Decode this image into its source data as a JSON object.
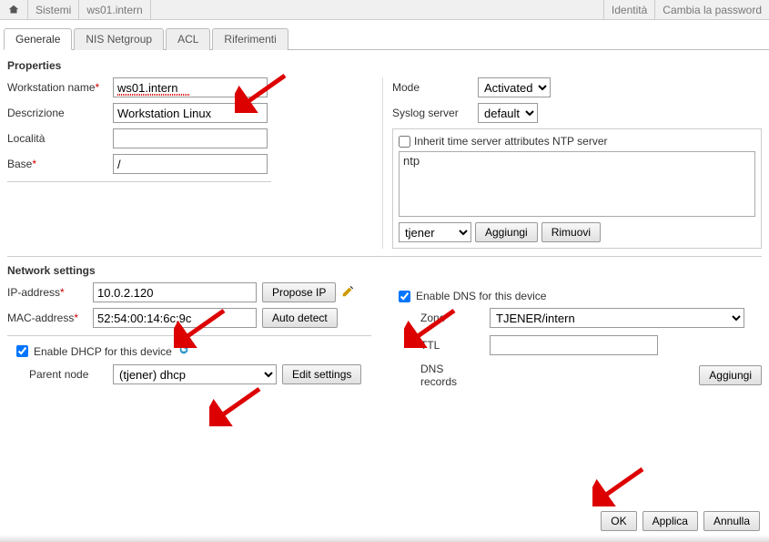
{
  "topbar": {
    "systems": "Sistemi",
    "node": "ws01.intern",
    "identity": "Identità",
    "change_password": "Cambia la password"
  },
  "tabs": {
    "general": "Generale",
    "nis": "NIS Netgroup",
    "acl": "ACL",
    "refs": "Riferimenti"
  },
  "sections": {
    "properties": "Properties",
    "network": "Network settings"
  },
  "props": {
    "workstation_label": "Workstation name",
    "workstation_value": "ws01.intern",
    "desc_label": "Descrizione",
    "desc_value": "Workstation Linux",
    "location_label": "Località",
    "location_value": "",
    "base_label": "Base",
    "base_value": "/",
    "mode_label": "Mode",
    "mode_value": "Activated",
    "syslog_label": "Syslog server",
    "syslog_value": "default",
    "ntp_inherit": "Inherit time server attributes NTP server",
    "ntp_item": "ntp",
    "ntp_select": "tjener",
    "add": "Aggiungi",
    "remove": "Rimuovi"
  },
  "net": {
    "ip_label": "IP-address",
    "ip_value": "10.0.2.120",
    "propose": "Propose IP",
    "mac_label": "MAC-address",
    "mac_value": "52:54:00:14:6c:9c",
    "autodetect": "Auto detect",
    "dhcp_label": "Enable DHCP for this device",
    "parent_label": "Parent node",
    "parent_value": "(tjener) dhcp",
    "edit": "Edit settings",
    "dns_enable": "Enable DNS for this device",
    "zone_label": "Zone",
    "zone_value": "TJENER/intern",
    "ttl_label": "TTL",
    "ttl_value": "",
    "records_label": "DNS records",
    "records_add": "Aggiungi"
  },
  "footer": {
    "ok": "OK",
    "apply": "Applica",
    "cancel": "Annulla"
  }
}
